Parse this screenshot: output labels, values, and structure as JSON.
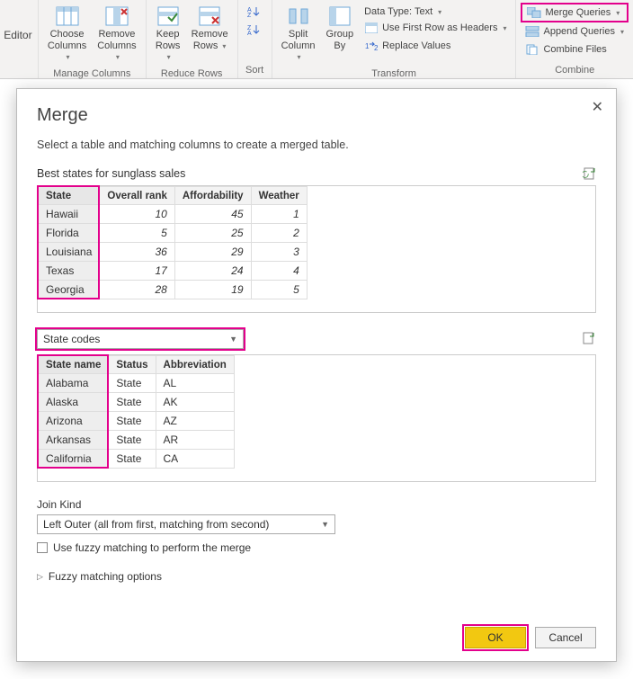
{
  "ribbon": {
    "editor_label": "Editor",
    "groups": {
      "manage_cols": {
        "label": "Manage Columns",
        "choose": "Choose\nColumns",
        "remove": "Remove\nColumns"
      },
      "reduce_rows": {
        "label": "Reduce Rows",
        "keep": "Keep\nRows",
        "remove": "Remove\nRows"
      },
      "sort": {
        "label": "Sort"
      },
      "transform": {
        "label": "Transform",
        "split": "Split\nColumn",
        "group": "Group\nBy",
        "data_type": "Data Type: Text",
        "first_row": "Use First Row as Headers",
        "replace": "Replace Values"
      },
      "combine": {
        "label": "Combine",
        "merge": "Merge Queries",
        "append": "Append Queries",
        "combine_files": "Combine Files"
      }
    }
  },
  "dialog": {
    "title": "Merge",
    "subtitle": "Select a table and matching columns to create a merged table.",
    "table1": {
      "name": "Best states for sunglass sales",
      "columns": [
        "State",
        "Overall rank",
        "Affordability",
        "Weather"
      ],
      "rows": [
        [
          "Hawaii",
          "10",
          "45",
          "1"
        ],
        [
          "Florida",
          "5",
          "25",
          "2"
        ],
        [
          "Louisiana",
          "36",
          "29",
          "3"
        ],
        [
          "Texas",
          "17",
          "24",
          "4"
        ],
        [
          "Georgia",
          "28",
          "19",
          "5"
        ]
      ]
    },
    "table2_selector": "State codes",
    "table2": {
      "columns": [
        "State name",
        "Status",
        "Abbreviation"
      ],
      "rows": [
        [
          "Alabama",
          "State",
          "AL"
        ],
        [
          "Alaska",
          "State",
          "AK"
        ],
        [
          "Arizona",
          "State",
          "AZ"
        ],
        [
          "Arkansas",
          "State",
          "AR"
        ],
        [
          "California",
          "State",
          "CA"
        ]
      ]
    },
    "join_kind_label": "Join Kind",
    "join_kind_value": "Left Outer (all from first, matching from second)",
    "fuzzy_check": "Use fuzzy matching to perform the merge",
    "fuzzy_options": "Fuzzy matching options",
    "ok": "OK",
    "cancel": "Cancel"
  }
}
